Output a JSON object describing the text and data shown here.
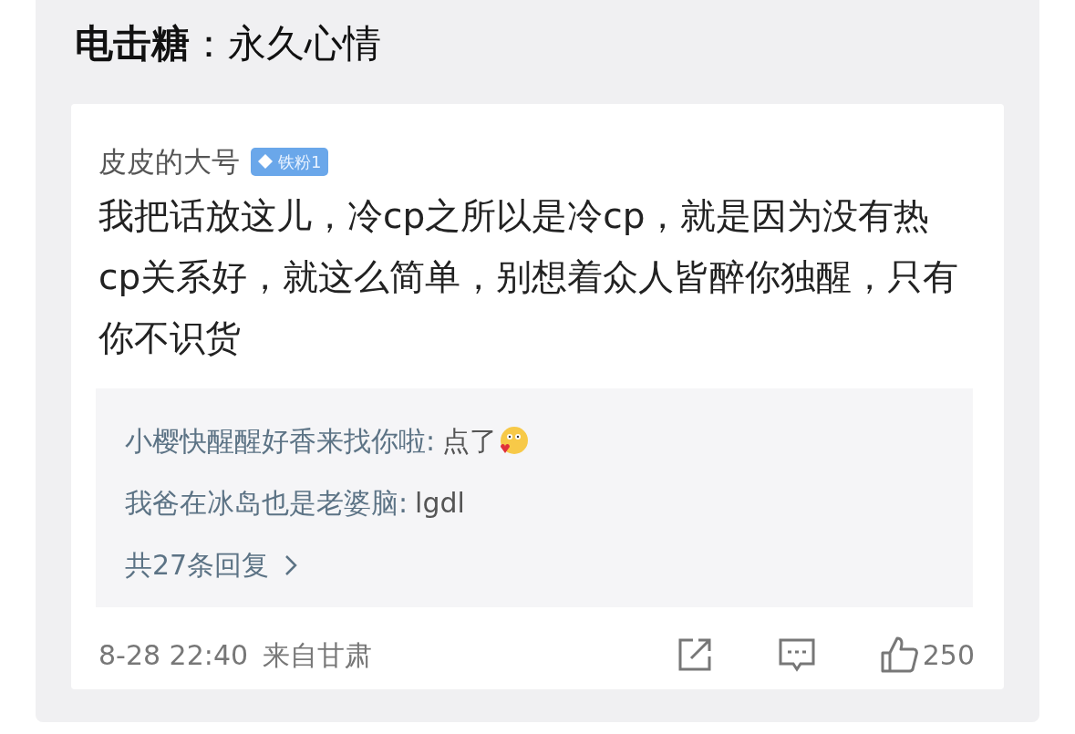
{
  "title": "**电击糖**：永久心情",
  "comment": {
    "author": "皮皮的大号",
    "badge": "铁粉1",
    "text": "我把话放这儿，冷cp之所以是冷cp，就是因为没有热cp关系好，就这么简单，别想着众人皆醉你独醒，只有你不识货",
    "replies": [
      {
        "name": "小樱快醒醒好香来找你啦:",
        "text": "点了",
        "emoji": true
      },
      {
        "name": "我爸在冰岛也是老婆脑:",
        "text": "lgdl",
        "emoji": false
      }
    ],
    "more_replies": "共27条回复",
    "time": "8-28 22:40",
    "source": "来自甘肃",
    "likes": "250"
  }
}
